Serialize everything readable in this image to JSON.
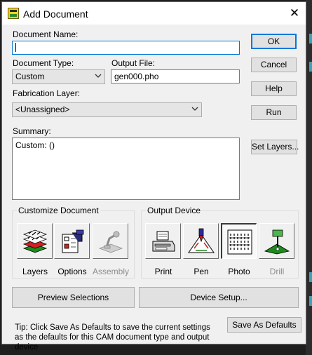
{
  "window": {
    "title": "Add Document",
    "close_glyph": "✕"
  },
  "fields": {
    "document_name": {
      "label": "Document Name:",
      "value": ""
    },
    "document_type": {
      "label": "Document Type:",
      "value": "Custom"
    },
    "output_file": {
      "label": "Output File:",
      "value": "gen000.pho"
    },
    "fabrication_layer": {
      "label": "Fabrication Layer:",
      "value": "<Unassigned>"
    },
    "summary": {
      "label": "Summary:",
      "value": "Custom: ()"
    }
  },
  "buttons": {
    "ok": "OK",
    "cancel": "Cancel",
    "help": "Help",
    "run": "Run",
    "set_layers": "Set Layers...",
    "preview_selections": "Preview Selections",
    "device_setup": "Device Setup...",
    "save_as_defaults": "Save As Defaults"
  },
  "customize_document": {
    "title": "Customize Document",
    "tiles": [
      {
        "label": "Layers",
        "icon": "layers-icon",
        "enabled": true
      },
      {
        "label": "Options",
        "icon": "options-icon",
        "enabled": true
      },
      {
        "label": "Assembly",
        "icon": "assembly-icon",
        "enabled": false
      }
    ]
  },
  "output_device": {
    "title": "Output Device",
    "selected": "Photo",
    "tiles": [
      {
        "label": "Print",
        "icon": "printer-icon",
        "enabled": true
      },
      {
        "label": "Pen",
        "icon": "pen-plotter-icon",
        "enabled": true
      },
      {
        "label": "Photo",
        "icon": "photo-film-icon",
        "enabled": true
      },
      {
        "label": "Drill",
        "icon": "drill-icon",
        "enabled": false
      }
    ]
  },
  "tip": "Tip: Click Save As Defaults to save the current settings as the defaults for this CAM document type and output device",
  "colors": {
    "accent": "#0078d7",
    "window_bg": "#f0f0f0",
    "desktop_bg": "#1e1e1e"
  }
}
